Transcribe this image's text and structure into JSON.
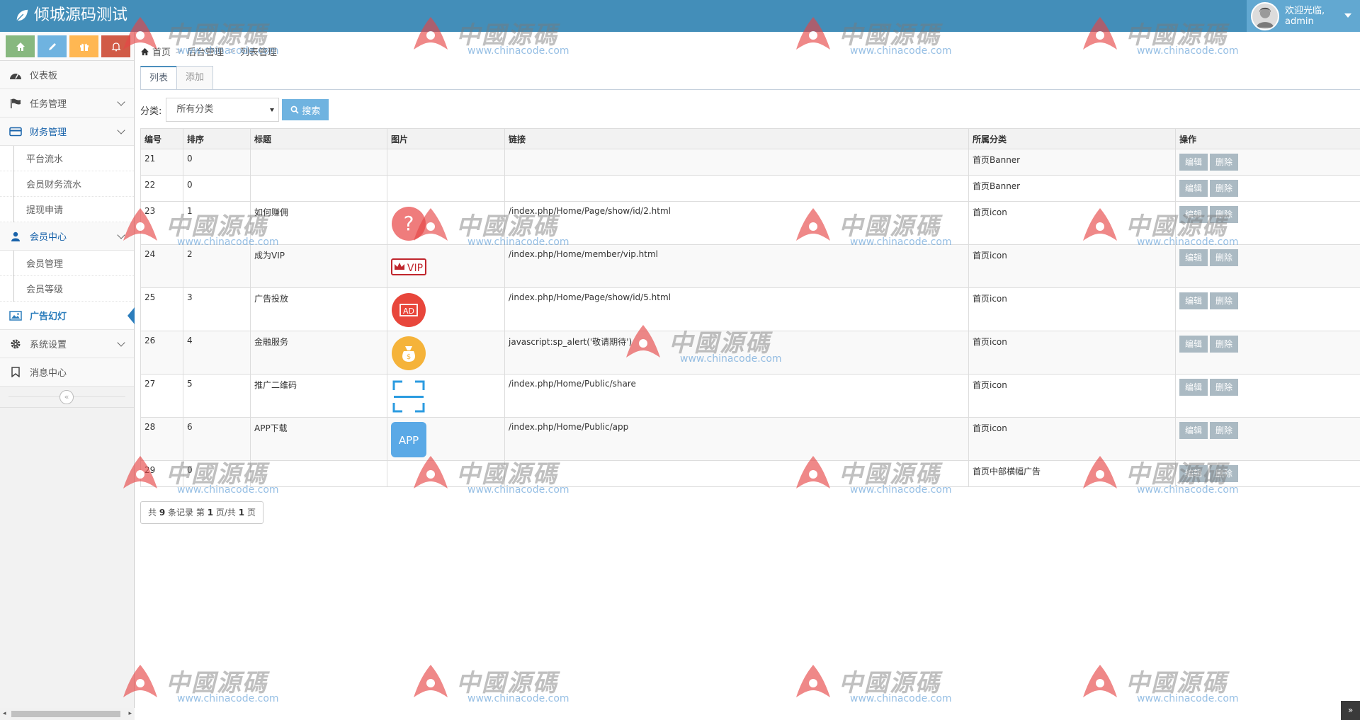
{
  "app": {
    "title": "倾城源码测试"
  },
  "user": {
    "greeting": "欢迎光临,",
    "name": "admin"
  },
  "sidebar": {
    "items": [
      {
        "label": "仪表板",
        "icon": "dashboard-icon"
      },
      {
        "label": "任务管理",
        "icon": "flag-icon"
      },
      {
        "label": "财务管理",
        "icon": "credit-card-icon"
      },
      {
        "label": "会员中心",
        "icon": "user-icon"
      },
      {
        "label": "广告幻灯",
        "icon": "picture-icon"
      },
      {
        "label": "系统设置",
        "icon": "gear-icon"
      },
      {
        "label": "消息中心",
        "icon": "bookmark-icon"
      }
    ],
    "finance_sub": [
      "平台流水",
      "会员财务流水",
      "提现申请"
    ],
    "member_sub": [
      "会员管理",
      "会员等级"
    ]
  },
  "breadcrumb": [
    "首页",
    "后台管理",
    "列表管理"
  ],
  "tabs": [
    "列表",
    "添加"
  ],
  "filter": {
    "label": "分类:",
    "selected": "所有分类",
    "search_label": "搜索"
  },
  "table": {
    "headers": [
      "编号",
      "排序",
      "标题",
      "图片",
      "链接",
      "所属分类",
      "操作"
    ],
    "edit_label": "编辑",
    "delete_label": "删除",
    "rows": [
      {
        "id": "21",
        "sort": "0",
        "title": "",
        "image": "",
        "link": "",
        "category": "首页Banner"
      },
      {
        "id": "22",
        "sort": "0",
        "title": "",
        "image": "",
        "link": "",
        "category": "首页Banner"
      },
      {
        "id": "23",
        "sort": "1",
        "title": "如何赚佣",
        "image": "question-icon",
        "link": "/index.php/Home/Page/show/id/2.html",
        "category": "首页icon"
      },
      {
        "id": "24",
        "sort": "2",
        "title": "成为VIP",
        "image": "vip-icon",
        "link": "/index.php/Home/member/vip.html",
        "category": "首页icon"
      },
      {
        "id": "25",
        "sort": "3",
        "title": "广告投放",
        "image": "ad-icon",
        "link": "/index.php/Home/Page/show/id/5.html",
        "category": "首页icon"
      },
      {
        "id": "26",
        "sort": "4",
        "title": "金融服务",
        "image": "money-bag-icon",
        "link": "javascript:sp_alert('敬请期待')",
        "category": "首页icon"
      },
      {
        "id": "27",
        "sort": "5",
        "title": "推广二维码",
        "image": "qr-scan-icon",
        "link": "/index.php/Home/Public/share",
        "category": "首页icon"
      },
      {
        "id": "28",
        "sort": "6",
        "title": "APP下载",
        "image": "app-icon",
        "link": "/index.php/Home/Public/app",
        "category": "首页icon"
      },
      {
        "id": "29",
        "sort": "0",
        "title": "",
        "image": "",
        "link": "",
        "category": "首页中部横幅广告"
      }
    ]
  },
  "pager": {
    "prefix": "共",
    "total": "9",
    "mid1": "条记录 第",
    "page": "1",
    "mid2": "页/共",
    "pages": "1",
    "suffix": "页"
  },
  "icon_labels": {
    "vip": "VIP",
    "ad": "AD",
    "app": "APP"
  },
  "watermark": {
    "cn": "中國源碼",
    "en": "www.chinacode.com"
  },
  "colors": {
    "navbar": "#438eb9",
    "accent": "#2b7dbc",
    "search": "#6fb3e0",
    "op_button": "#abbac3"
  }
}
